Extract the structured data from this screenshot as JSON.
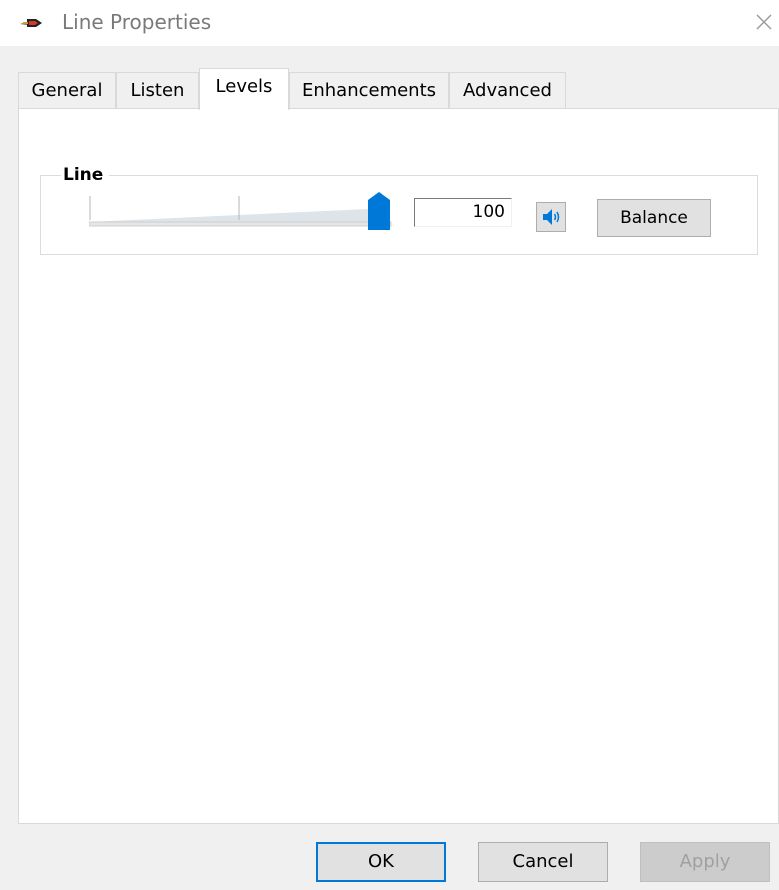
{
  "window": {
    "title": "Line Properties",
    "icon": "audio-line-in-icon",
    "close_icon": "close-icon"
  },
  "tabs": [
    {
      "label": "General",
      "active": false
    },
    {
      "label": "Listen",
      "active": false
    },
    {
      "label": "Levels",
      "active": true
    },
    {
      "label": "Enhancements",
      "active": false
    },
    {
      "label": "Advanced",
      "active": false
    }
  ],
  "levels": {
    "group_label": "Line",
    "volume": 100,
    "volume_text": "100",
    "volume_fraction": 1.0,
    "mute_icon": "speaker-icon",
    "balance_label": "Balance"
  },
  "footer": {
    "ok_label": "OK",
    "cancel_label": "Cancel",
    "apply_label": "Apply",
    "apply_enabled": false
  },
  "colors": {
    "accent": "#0078d7",
    "window_bg": "#f0f0f0",
    "panel_bg": "#ffffff"
  }
}
